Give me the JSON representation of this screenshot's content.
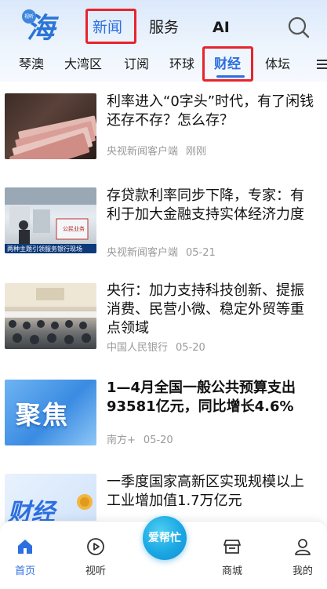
{
  "header": {
    "logo_badge": "视听",
    "logo_text": "海",
    "tabs": [
      {
        "label": "新闻",
        "active": true
      },
      {
        "label": "服务",
        "active": false
      },
      {
        "label": "AI",
        "active": false
      }
    ],
    "search_icon": "search-icon"
  },
  "channels": [
    {
      "label": "琴澳",
      "active": false
    },
    {
      "label": "大湾区",
      "active": false
    },
    {
      "label": "订阅",
      "active": false
    },
    {
      "label": "环球",
      "active": false
    },
    {
      "label": "财经",
      "active": true
    },
    {
      "label": "体坛",
      "active": false
    }
  ],
  "news": [
    {
      "title": "利率进入“0字头”时代，有了闲钱还存不存？怎么存？",
      "source": "央视新闻客户端",
      "time": "刚刚"
    },
    {
      "title": "存贷款利率同步下降，专家：有利于加大金融支持实体经济力度",
      "source": "央视新闻客户端",
      "time": "05-21"
    },
    {
      "title": "央行：加力支持科技创新、提振消费、民营小微、稳定外贸等重点领域",
      "source": "中国人民银行",
      "time": "05-20"
    },
    {
      "title": "1—4月全国一般公共预算支出93581亿元，同比增长4.6%",
      "source": "南方+",
      "time": "05-20"
    },
    {
      "title": "一季度国家高新区实现规模以上工业增加值1.7万亿元",
      "source": "",
      "time": ""
    }
  ],
  "thumb_texts": {
    "bank_caption": "两种主题引领服务银行现场",
    "bank_sign": "公民业务",
    "focus": "聚焦",
    "finance": "财经"
  },
  "bottom_nav": {
    "home": "首页",
    "listen": "视听",
    "help": "爱帮忙",
    "mall": "商城",
    "mine": "我的"
  },
  "colors": {
    "accent": "#2c6fe0",
    "highlight_box": "#e8232d",
    "help_button": "#1aa7e3"
  }
}
